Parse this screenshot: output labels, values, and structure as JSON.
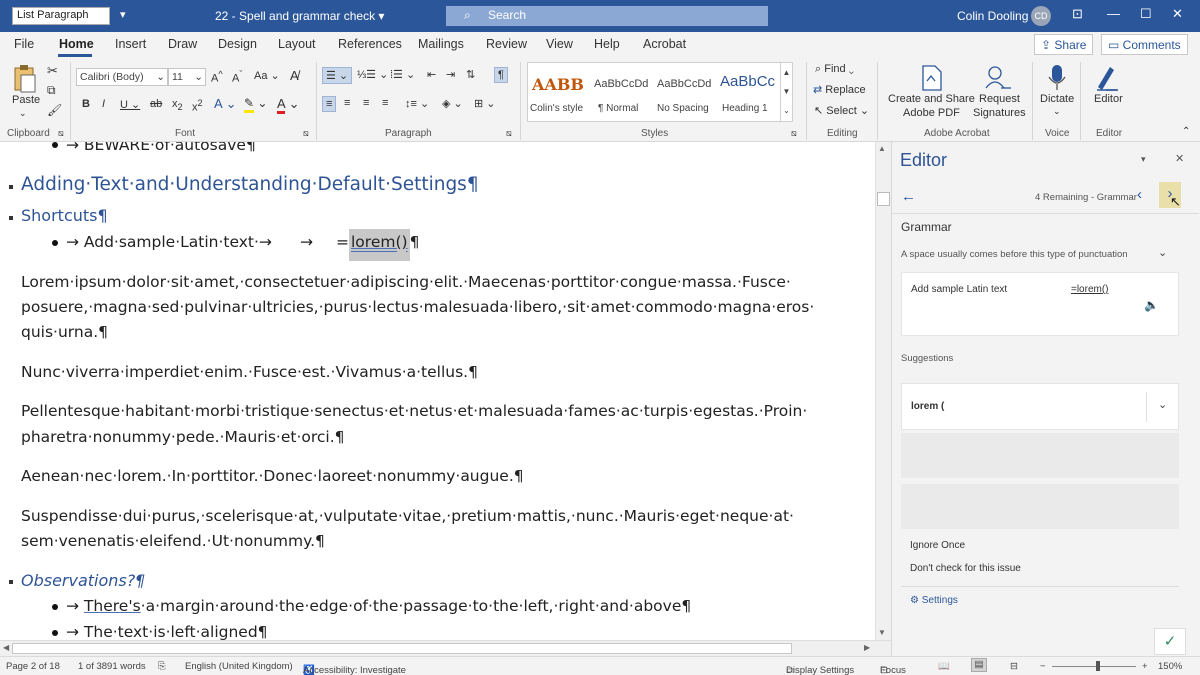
{
  "titlebar": {
    "style_box": "List Paragraph",
    "doc_title": "22 - Spell and grammar check",
    "search": "Search",
    "user": "Colin Dooling",
    "initials": "CD"
  },
  "menu": {
    "tabs": [
      "File",
      "Home",
      "Insert",
      "Draw",
      "Design",
      "Layout",
      "References",
      "Mailings",
      "Review",
      "View",
      "Help",
      "Acrobat"
    ],
    "share": "Share",
    "comments": "Comments"
  },
  "ribbon": {
    "paste": "Paste",
    "clipboard": "Clipboard",
    "font_name": "Calibri (Body)",
    "font_size": "11",
    "font": "Font",
    "paragraph": "Paragraph",
    "styles_label": "Styles",
    "styles": [
      {
        "preview": "AABB",
        "name": "Colin's style"
      },
      {
        "preview": "AaBbCcDd",
        "name": "¶ Normal"
      },
      {
        "preview": "AaBbCcDd",
        "name": "No Spacing"
      },
      {
        "preview": "AaBbCc",
        "name": "Heading 1"
      }
    ],
    "find": "Find",
    "replace": "Replace",
    "select": "Select",
    "editing": "Editing",
    "create_share_1": "Create and Share",
    "create_share_2": "Adobe PDF",
    "request_1": "Request",
    "request_2": "Signatures",
    "adobe": "Adobe Acrobat",
    "dictate": "Dictate",
    "voice": "Voice",
    "editor_btn": "Editor",
    "editor_group": "Editor"
  },
  "document": {
    "line_top": "→ BEWARE·of·autosave¶",
    "h1": "Adding·Text·and·Understanding·Default·Settings¶",
    "h2_shortcuts": "Shortcuts¶",
    "bullet1_text": "→ Add·sample·Latin·text·→",
    "bullet1_arrow": "→",
    "bullet1_formula_pre": "=",
    "bullet1_formula_word": "lorem()",
    "bullet1_pilcrow": "¶",
    "p1_l1": "Lorem·ipsum·dolor·sit·amet,·consectetuer·adipiscing·elit.·Maecenas·porttitor·congue·massa.·Fusce·",
    "p1_l2": "posuere,·magna·sed·pulvinar·ultricies,·purus·lectus·malesuada·libero,·sit·amet·commodo·magna·eros·",
    "p1_l3": "quis·urna.¶",
    "p2": "Nunc·viverra·imperdiet·enim.·Fusce·est.·Vivamus·a·tellus.¶",
    "p3_l1": "Pellentesque·habitant·morbi·tristique·senectus·et·netus·et·malesuada·fames·ac·turpis·egestas.·Proin·",
    "p3_l2": "pharetra·nonummy·pede.·Mauris·et·orci.¶",
    "p4": "Aenean·nec·lorem.·In·porttitor.·Donec·laoreet·nonummy·augue.¶",
    "p5_l1": "Suspendisse·dui·purus,·scelerisque·at,·vulputate·vitae,·pretium·mattis,·nunc.·Mauris·eget·neque·at·",
    "p5_l2": "sem·venenatis·eleifend.·Ut·nonummy.¶",
    "h2_obs": "Observations?¶",
    "b2_arrow": "→ ",
    "b2_there": "There's",
    "b2_rest": "·a·margin·around·the·edge·of·the·passage·to·the·left,·right·and·above¶",
    "b3": "→ The·text·is·left·aligned¶"
  },
  "editor_pane": {
    "title": "Editor",
    "remaining": "4 Remaining - Grammar",
    "section": "Grammar",
    "issue": "A space usually comes before this type of punctuation",
    "context_text": "Add sample Latin text",
    "context_formula": "=lorem()",
    "suggestions": "Suggestions",
    "suggestion1": "lorem (",
    "ignore": "Ignore Once",
    "dont_check": "Don't check for this issue",
    "settings": "Settings"
  },
  "status": {
    "page": "Page 2 of 18",
    "words": "1 of 3891 words",
    "language": "English (United Kingdom)",
    "accessibility": "Accessibility: Investigate",
    "display": "Display Settings",
    "focus": "Focus",
    "zoom": "150%"
  }
}
